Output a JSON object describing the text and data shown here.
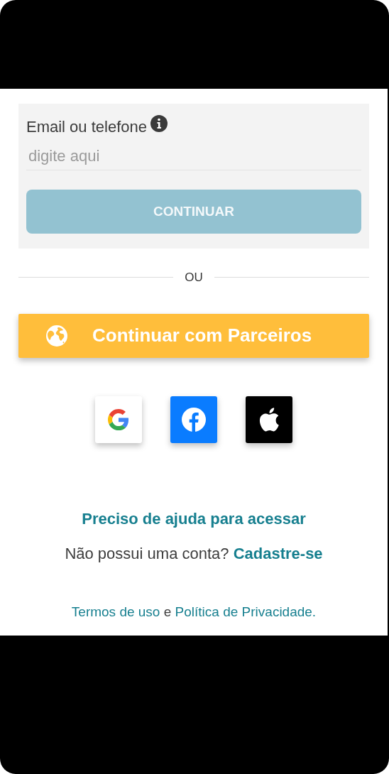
{
  "login_form": {
    "label": "Email ou telefone",
    "placeholder": "digite aqui",
    "continue_button": {
      "label": "CONTINUAR",
      "disabled": true
    }
  },
  "divider": {
    "label": "OU"
  },
  "partners_button": {
    "label": "Continuar com Parceiros"
  },
  "social_buttons": [
    {
      "kind": "google"
    },
    {
      "kind": "facebook"
    },
    {
      "kind": "apple"
    }
  ],
  "help_link": "Preciso de ajuda para acessar",
  "signup": {
    "text": "Não possui uma conta?",
    "link": "Cadastre-se"
  },
  "legal": {
    "terms": "Termos de uso",
    "joiner": "e",
    "privacy": "Política de Privacidade."
  }
}
